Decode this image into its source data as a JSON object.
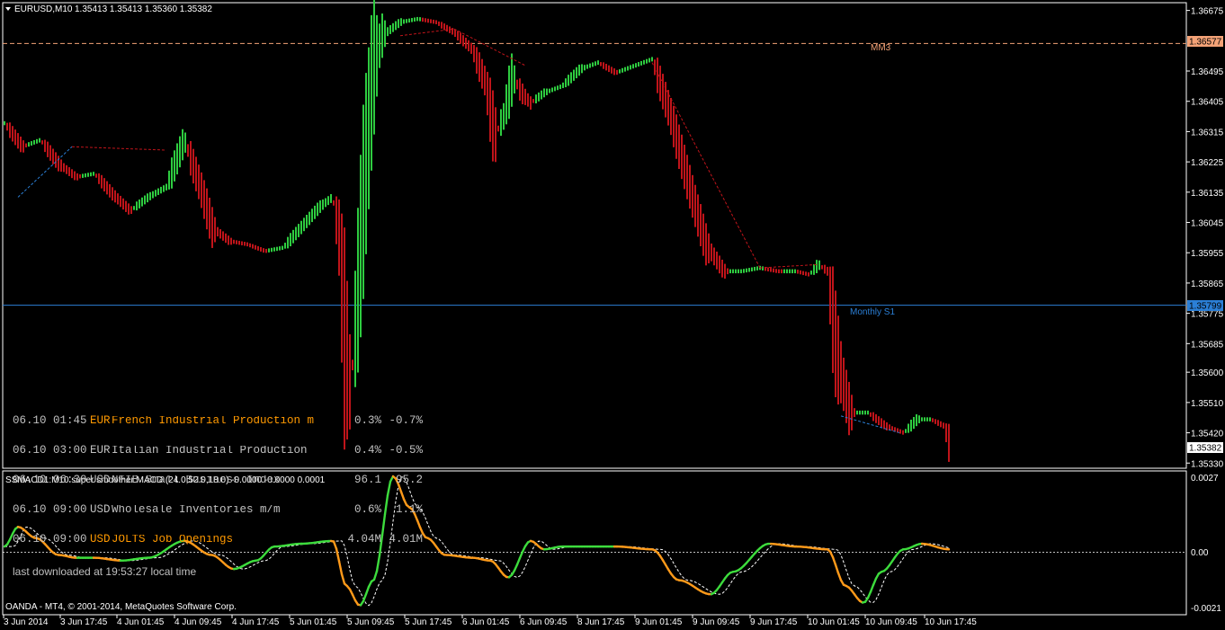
{
  "header": {
    "symbol": "EURUSD,M10",
    "ohlc": "1.35413 1.35413 1.35360 1.35382"
  },
  "main_axis": {
    "ticks": [
      "1.36675",
      "1.36495",
      "1.36405",
      "1.36315",
      "1.36225",
      "1.36135",
      "1.36045",
      "1.35955",
      "1.35865",
      "1.35775",
      "1.35685",
      "1.35600",
      "1.35510",
      "1.35420",
      "1.35330"
    ],
    "mm3_price": "1.36577",
    "monthly_s1_price": "1.35799",
    "current_price": "1.35382"
  },
  "levels": {
    "mm3_label": "MM3",
    "monthly_s1_label": "Monthly S1"
  },
  "news": {
    "rows": [
      {
        "time": "06.10 01:45",
        "currency": "EUR",
        "event": "French Industrial Production m",
        "actual": "0.3%",
        "prior": "-0.7%",
        "highlight": true
      },
      {
        "time": "06.10 03:00",
        "currency": "EUR",
        "event": "Italian Industrial Production",
        "actual": "0.4%",
        "prior": "-0.5%",
        "highlight": false
      },
      {
        "time": "06.10 06:30",
        "currency": "USD",
        "event": "NFIB Small Business Index",
        "actual": "96.1",
        "prior": "95.2",
        "highlight": false
      },
      {
        "time": "06.10 09:00",
        "currency": "USD",
        "event": "Wholesale Inventories m/m",
        "actual": "0.6%",
        "prior": "1.1%",
        "highlight": false
      },
      {
        "time": "06.10 09:00",
        "currency": "USD",
        "event": "JOLTS Job Openings",
        "actual": "4.04M",
        "prior": "4.01M",
        "highlight": true
      }
    ],
    "footer": "last downloaded at 19:53:27 local time"
  },
  "sub": {
    "title": "SSMACD1:M10 super smoother MACD (24.0,52.0,18.0) -0.0000 -0.0000 0.0001",
    "ticks": [
      "0.0027",
      "0.00",
      "-0.0021"
    ],
    "copyright": "OANDA - MT4, © 2001-2014, MetaQuotes Software Corp."
  },
  "time_axis": [
    "3 Jun 2014",
    "3 Jun 17:45",
    "4 Jun 01:45",
    "4 Jun 09:45",
    "4 Jun 17:45",
    "5 Jun 01:45",
    "5 Jun 09:45",
    "5 Jun 17:45",
    "6 Jun 01:45",
    "6 Jun 09:45",
    "8 Jun 17:45",
    "9 Jun 01:45",
    "9 Jun 09:45",
    "9 Jun 17:45",
    "10 Jun 01:45",
    "10 Jun 09:45",
    "10 Jun 17:45"
  ],
  "chart_data": [
    {
      "type": "line",
      "title": "EURUSD,M10",
      "ylim": [
        1.3532,
        1.3669
      ],
      "x": [
        0,
        20,
        40,
        60,
        80,
        100,
        120,
        140,
        160,
        180,
        200,
        218,
        231,
        250,
        270,
        290,
        310,
        330,
        350,
        365,
        372,
        378,
        385,
        392,
        400,
        410,
        420,
        440,
        460,
        480,
        500,
        520,
        535,
        545,
        555,
        565,
        575,
        585,
        600,
        620,
        640,
        660,
        680,
        700,
        710,
        720,
        740,
        760,
        780,
        800,
        820,
        840,
        860,
        880,
        895,
        905,
        915,
        925,
        940,
        960,
        980,
        1000,
        1015,
        1030,
        1045,
        1050
      ],
      "values": [
        1.3634,
        1.3627,
        1.3629,
        1.3622,
        1.3618,
        1.3619,
        1.3613,
        1.3608,
        1.3612,
        1.3615,
        1.3629,
        1.3615,
        1.3603,
        1.3599,
        1.3598,
        1.3596,
        1.3597,
        1.3603,
        1.3609,
        1.3612,
        1.36,
        1.357,
        1.3555,
        1.358,
        1.3615,
        1.365,
        1.366,
        1.3664,
        1.3665,
        1.3664,
        1.3661,
        1.3656,
        1.3646,
        1.363,
        1.3636,
        1.3648,
        1.3643,
        1.364,
        1.3643,
        1.3645,
        1.365,
        1.3652,
        1.3649,
        1.3651,
        1.3652,
        1.3653,
        1.3637,
        1.3617,
        1.3598,
        1.359,
        1.359,
        1.3591,
        1.359,
        1.359,
        1.3589,
        1.3592,
        1.359,
        1.3566,
        1.3548,
        1.3548,
        1.3544,
        1.3542,
        1.3546,
        1.3546,
        1.3544,
        1.3539
      ],
      "reference_lines": [
        {
          "label": "MM3",
          "value": 1.36577
        },
        {
          "label": "Monthly S1",
          "value": 1.35799
        }
      ],
      "current_price": 1.35382
    },
    {
      "type": "line",
      "title": "SSMACD1:M10 super smoother MACD (24.0,52.0,18.0) -0.0000 -0.0000 0.0001",
      "ylim": [
        -0.0021,
        0.0027
      ],
      "x": [
        0,
        15,
        35,
        60,
        80,
        100,
        130,
        160,
        200,
        230,
        255,
        280,
        300,
        330,
        365,
        380,
        395,
        410,
        432,
        450,
        470,
        490,
        520,
        540,
        560,
        585,
        600,
        620,
        650,
        680,
        720,
        750,
        785,
        810,
        850,
        880,
        915,
        935,
        955,
        975,
        1000,
        1020,
        1050
      ],
      "series": [
        {
          "values": [
            0.0002,
            0.0009,
            0.0005,
            -0.0001,
            -0.0002,
            -0.0002,
            -0.0003,
            -0.0002,
            0.0004,
            -0.0001,
            -0.0006,
            -0.0003,
            0.0002,
            0.0003,
            0.0004,
            -0.0012,
            -0.0019,
            -0.001,
            0.0027,
            0.0016,
            0.0005,
            -0.0001,
            -0.0002,
            -0.0003,
            -0.0009,
            0.0004,
            0.0001,
            0.0002,
            0.0002,
            0.0002,
            0.0001,
            -0.001,
            -0.0015,
            -0.0007,
            0.0003,
            0.0002,
            0.0001,
            -0.0012,
            -0.0018,
            -0.0007,
            0.0001,
            0.0003,
            0.0001
          ]
        }
      ]
    }
  ],
  "colors": {
    "background": "#000000",
    "bull": "#2ecc40",
    "bear": "#c0141a",
    "price_line": "#ffffff",
    "mm3": "#f3a277",
    "monthly_s1": "#2b7fd6",
    "macd_up": "#3ddc3d",
    "macd_down": "#ff9a1a",
    "news_highlight": "#ff9900"
  }
}
